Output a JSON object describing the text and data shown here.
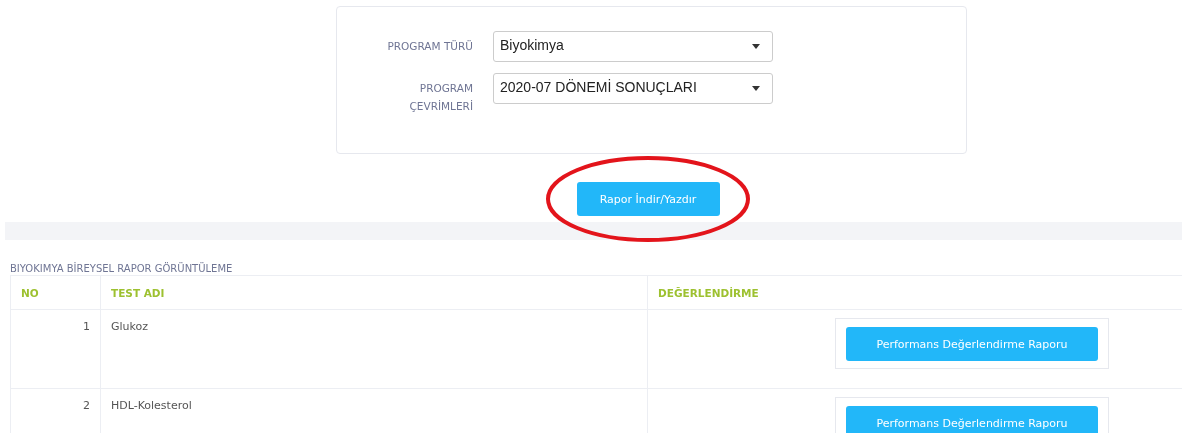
{
  "filters": [
    {
      "label": "PROGRAM TÜRÜ",
      "value": "Biyokimya"
    },
    {
      "label": "PROGRAM ÇEVRİMLERİ",
      "value": "2020-07 DÖNEMİ SONUÇLARI"
    }
  ],
  "download_button": "Rapor İndir/Yazdır",
  "annotation": {
    "kind": "ellipse",
    "color": "#e3141b"
  },
  "report": {
    "title": "BIYOKIMYA BİREYSEL RAPOR GÖRÜNTÜLEME",
    "columns": [
      "NO",
      "TEST ADI",
      "DEĞERLENDİRME"
    ],
    "rows": [
      {
        "no": "1",
        "test": "Glukoz",
        "action": "Performans Değerlendirme Raporu"
      },
      {
        "no": "2",
        "test": "HDL-Kolesterol",
        "action": "Performans Değerlendirme Raporu"
      }
    ]
  }
}
